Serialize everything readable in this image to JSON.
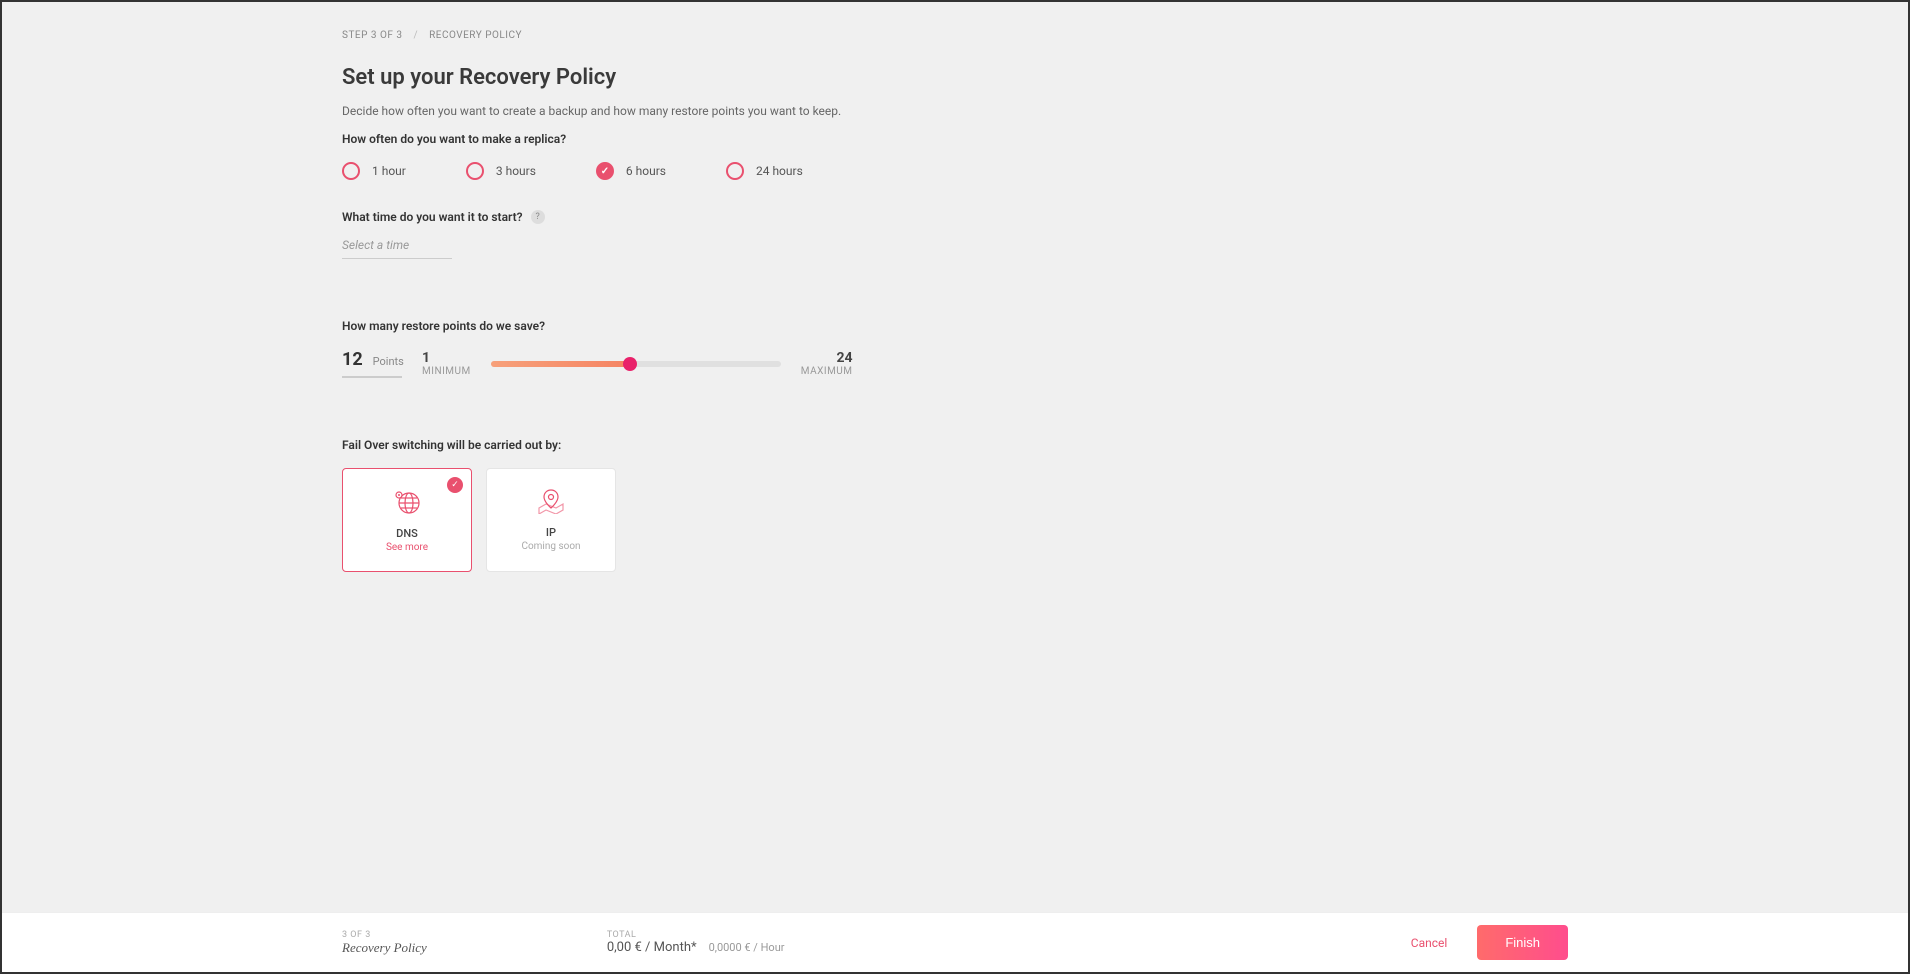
{
  "breadcrumb": {
    "step": "STEP 3 OF 3",
    "current": "RECOVERY POLICY"
  },
  "title": "Set up your Recovery Policy",
  "description": "Decide how often you want to create a backup and how many restore points you want to keep.",
  "frequency": {
    "label": "How often do you want to make a replica?",
    "options": [
      "1 hour",
      "3 hours",
      "6 hours",
      "24 hours"
    ],
    "selected": "6 hours"
  },
  "startTime": {
    "label": "What time do you want it to start?",
    "placeholder": "Select a time"
  },
  "restorePoints": {
    "label": "How many restore points do we save?",
    "value": "12",
    "unit": "Points",
    "min": "1",
    "minLabel": "MINIMUM",
    "max": "24",
    "maxLabel": "MAXIMUM"
  },
  "failover": {
    "label": "Fail Over switching will be carried out by:",
    "options": [
      {
        "title": "DNS",
        "sub": "See more",
        "selected": true
      },
      {
        "title": "IP",
        "sub": "Coming soon",
        "selected": false
      }
    ]
  },
  "footer": {
    "stepLabel": "3 OF 3",
    "stepTitle": "Recovery Policy",
    "totalLabel": "TOTAL",
    "priceMonth": "0,00 € / Month*",
    "priceHour": "0,0000 € / Hour",
    "cancel": "Cancel",
    "finish": "Finish"
  }
}
